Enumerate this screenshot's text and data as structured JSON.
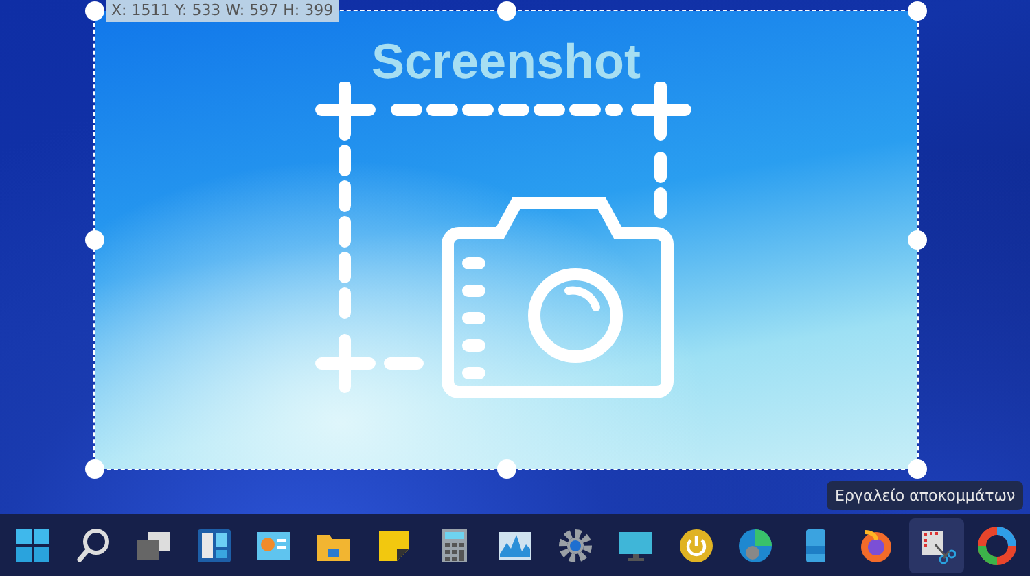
{
  "selection": {
    "readout": "X: 1511 Y: 533 W: 597 H: 399",
    "image_title": "Screenshot"
  },
  "tooltip": {
    "text": "Εργαλείο αποκομμάτων"
  },
  "taskbar": {
    "items": [
      {
        "kind": "start",
        "selected": false
      },
      {
        "kind": "search",
        "selected": false
      },
      {
        "kind": "taskview",
        "selected": false
      },
      {
        "kind": "panels",
        "selected": false
      },
      {
        "kind": "dashboard",
        "selected": false
      },
      {
        "kind": "folder",
        "selected": false
      },
      {
        "kind": "note",
        "selected": false
      },
      {
        "kind": "calculator",
        "selected": false
      },
      {
        "kind": "graph",
        "selected": false
      },
      {
        "kind": "gear",
        "selected": false
      },
      {
        "kind": "display",
        "selected": false
      },
      {
        "kind": "power",
        "selected": false
      },
      {
        "kind": "edge",
        "selected": false
      },
      {
        "kind": "phone",
        "selected": false
      },
      {
        "kind": "firefox",
        "selected": false
      },
      {
        "kind": "snip",
        "selected": true
      },
      {
        "kind": "ring",
        "selected": false
      }
    ]
  }
}
